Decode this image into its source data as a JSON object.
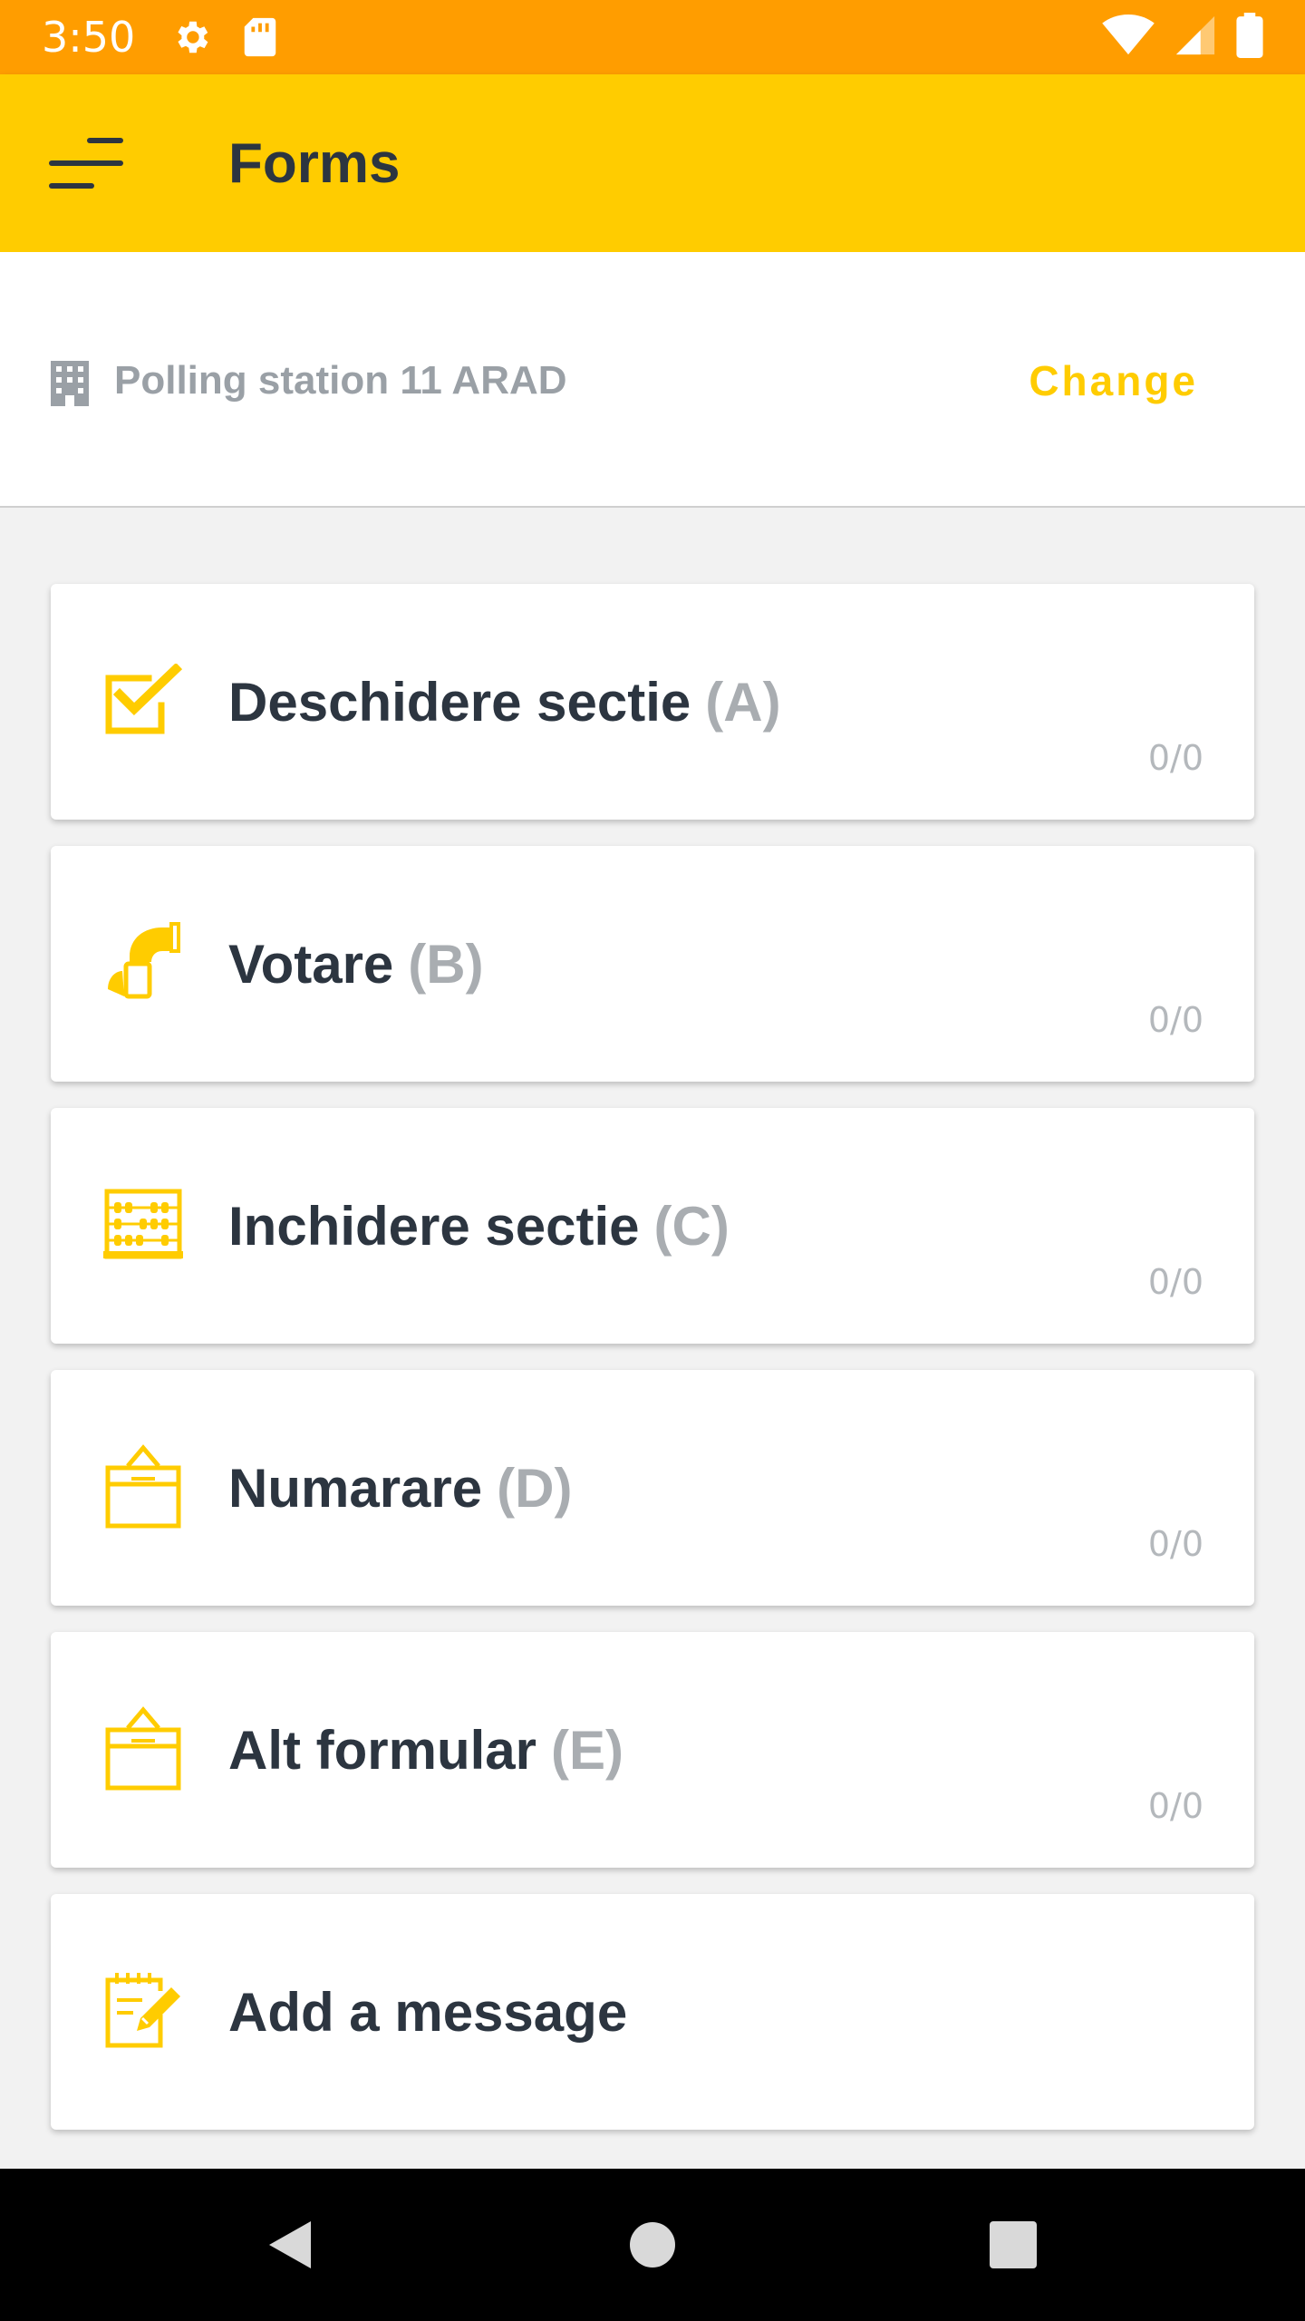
{
  "status_bar": {
    "time": "3:50",
    "icons": [
      "gear-icon",
      "sd-card-icon",
      "wifi-icon",
      "signal-icon",
      "battery-icon"
    ]
  },
  "app_bar": {
    "title": "Forms",
    "menu_icon": "menu-icon"
  },
  "station": {
    "name": "Polling station 11 ARAD",
    "change_label": "Change",
    "icon": "building-icon"
  },
  "forms": [
    {
      "title": "Deschidere sectie",
      "code": "(A)",
      "progress": "0/0",
      "icon": "checkbox-icon"
    },
    {
      "title": "Votare",
      "code": "(B)",
      "progress": "0/0",
      "icon": "ballot-hand-icon"
    },
    {
      "title": "Inchidere sectie",
      "code": "(C)",
      "progress": "0/0",
      "icon": "abacus-icon"
    },
    {
      "title": "Numarare",
      "code": "(D)",
      "progress": "0/0",
      "icon": "ballot-box-icon"
    },
    {
      "title": "Alt formular",
      "code": "(E)",
      "progress": "0/0",
      "icon": "ballot-box-icon"
    }
  ],
  "message": {
    "label": "Add a message",
    "icon": "note-edit-icon"
  },
  "colors": {
    "status_bar": "#ff9d00",
    "app_bar": "#ffcc00",
    "accent": "#ffcc00",
    "text_dark": "#2c3540",
    "text_muted": "#a9adb1"
  }
}
